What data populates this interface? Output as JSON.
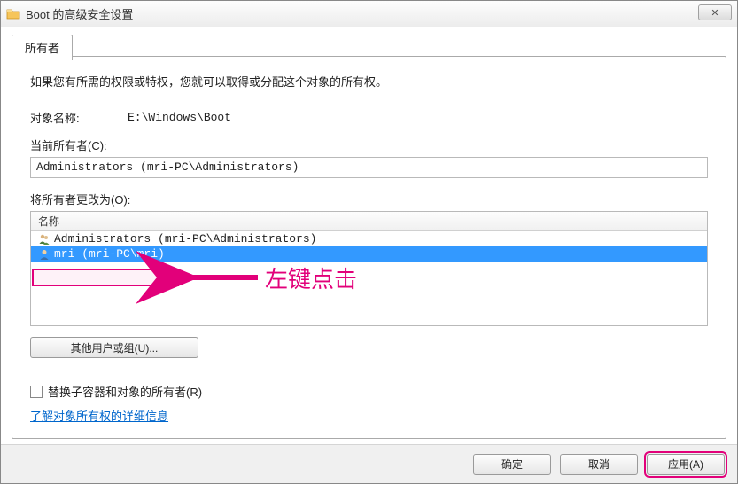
{
  "window": {
    "title": "Boot 的高级安全设置",
    "close_glyph": "✕"
  },
  "tab": {
    "owner": "所有者"
  },
  "panel": {
    "description": "如果您有所需的权限或特权，您就可以取得或分配这个对象的所有权。",
    "object_name_label": "对象名称:",
    "object_name_value": "E:\\Windows\\Boot",
    "current_owner_label": "当前所有者(C):",
    "current_owner_value": "Administrators (mri-PC\\Administrators)",
    "change_owner_to_label": "将所有者更改为(O):",
    "list_header": "名称",
    "owners": [
      {
        "display": "Administrators (mri-PC\\Administrators)",
        "selected": false
      },
      {
        "display": "mri (mri-PC\\mri)",
        "selected": true
      }
    ],
    "other_users_button": "其他用户或组(U)...",
    "replace_checkbox_label": "替换子容器和对象的所有者(R)",
    "learn_link": "了解对象所有权的详细信息"
  },
  "buttons": {
    "ok": "确定",
    "cancel": "取消",
    "apply": "应用(A)"
  },
  "annotation": {
    "text": "左键点击",
    "color": "#e2007a"
  }
}
